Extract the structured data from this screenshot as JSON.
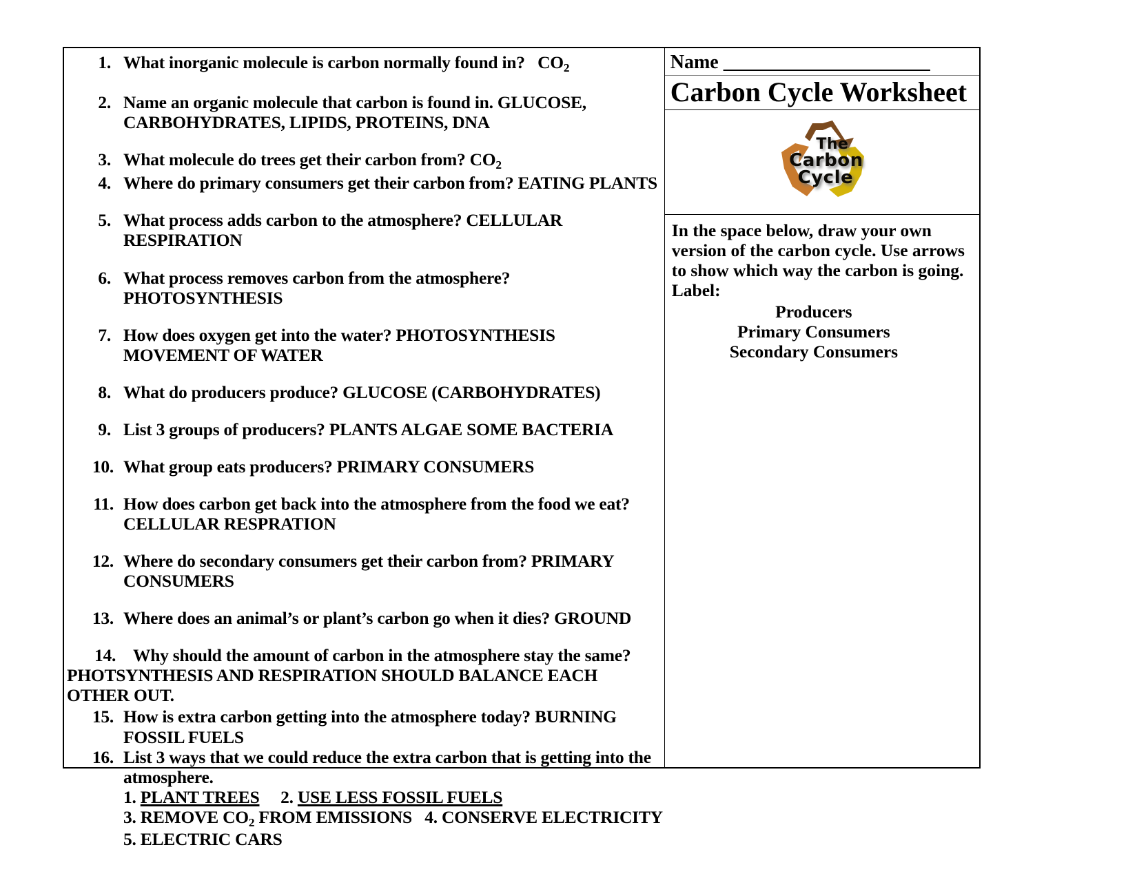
{
  "document": {
    "type": "worksheet",
    "title": "Carbon Cycle Worksheet"
  },
  "left_column": {
    "questions": [
      {
        "num": "1.",
        "text_html": "What inorganic molecule is carbon normally found in?   CO<sub>2</sub>",
        "text": "What inorganic molecule is carbon normally found in?   CO2"
      },
      {
        "num": "2.",
        "text": "Name an organic molecule that carbon is found in. GLUCOSE, CARBOHYDRATES, LIPIDS, PROTEINS, DNA"
      },
      {
        "num": "3.",
        "text_html": "What molecule do trees get their carbon from? CO<sub>2</sub>",
        "text": "What molecule do trees get their carbon from? CO2"
      },
      {
        "num": "4.",
        "text": "Where do primary consumers get their carbon from? EATING PLANTS"
      },
      {
        "num": "5.",
        "text": "What process adds carbon to the atmosphere? CELLULAR RESPIRATION"
      },
      {
        "num": "6.",
        "text": "What process removes carbon from the atmosphere? PHOTOSYNTHESIS"
      },
      {
        "num": "7.",
        "text": "How does oxygen get into the water? PHOTOSYNTHESIS   MOVEMENT OF WATER"
      },
      {
        "num": "8.",
        "text": "What do producers produce? GLUCOSE  (CARBOHYDRATES)"
      },
      {
        "num": "9.",
        "text": "List 3 groups of producers?  PLANTS    ALGAE     SOME BACTERIA"
      },
      {
        "num": "10.",
        "text": "What group eats producers? PRIMARY CONSUMERS"
      },
      {
        "num": "11.",
        "text": "How does carbon get back into the atmosphere from the food we eat? CELLULAR RESPRATION"
      },
      {
        "num": "12.",
        "text": "Where do secondary consumers get their carbon from? PRIMARY CONSUMERS"
      },
      {
        "num": "13.",
        "text": "Where does an animal’s or plant’s carbon go when it dies? GROUND"
      },
      {
        "num": "14.",
        "text_line1": "Why should the amount of carbon in the atmosphere stay the same?",
        "text_line2": "PHOTSYNTHESIS AND RESPIRATION SHOULD BALANCE EACH OTHER OUT."
      },
      {
        "num": "15.",
        "text": "How is extra carbon getting into the atmosphere today? BURNING FOSSIL FUELS"
      },
      {
        "num": "16.",
        "text": "List 3 ways that we could reduce the extra carbon that is getting into the atmosphere."
      }
    ],
    "q16_answers": {
      "line1": {
        "a_num": "1.",
        "a_text": "PLANT TREES",
        "b_num": "2.",
        "b_text": "USE LESS FOSSIL FUELS"
      },
      "line2_html": "3. REMOVE CO<sub>2</sub> FROM EMISSIONS   4. CONSERVE ELECTRICITY",
      "line2": "3. REMOVE CO2 FROM EMISSIONS   4. CONSERVE ELECTRICITY",
      "line3": "5. ELECTRIC CARS"
    }
  },
  "right_column": {
    "name_label": "Name",
    "name_blank": "_______________________",
    "title": "Carbon Cycle Worksheet",
    "logo": {
      "icon": "recycle-icon",
      "line1": "The",
      "line2": "Carbon",
      "line3": "Cycle",
      "colors": {
        "arrow_top": "#7B4A1E",
        "arrow_left": "#C87A2E",
        "arrow_right": "#D4B40A",
        "text": "#0C0A06"
      }
    },
    "instructions": "In the space below, draw your own version of the carbon cycle. Use arrows to show which way the carbon is going.",
    "label_heading": "Label:",
    "labels": [
      "Producers",
      "Primary Consumers",
      "Secondary Consumers"
    ]
  }
}
